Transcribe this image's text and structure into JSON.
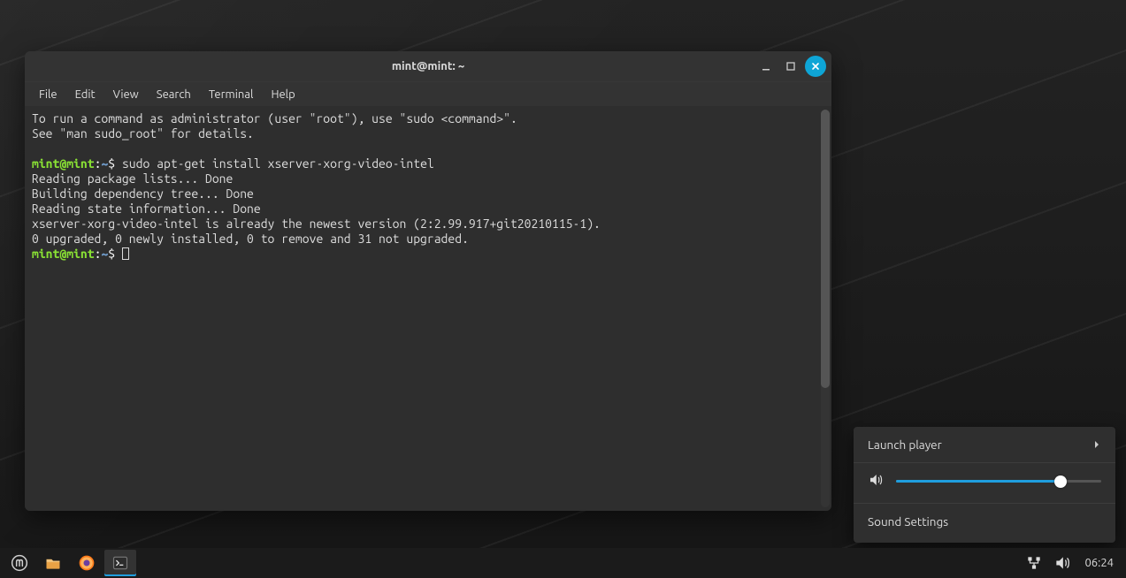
{
  "window": {
    "title": "mint@mint: ~",
    "menu": [
      "File",
      "Edit",
      "View",
      "Search",
      "Terminal",
      "Help"
    ]
  },
  "terminal": {
    "prompt": {
      "user": "mint",
      "host": "mint",
      "path": "~",
      "sigil": "$"
    },
    "lines": {
      "l0": "To run a command as administrator (user \"root\"), use \"sudo <command>\".",
      "l1": "See \"man sudo_root\" for details.",
      "cmd1": "sudo apt-get install xserver-xorg-video-intel",
      "l3": "Reading package lists... Done",
      "l4": "Building dependency tree... Done",
      "l5": "Reading state information... Done",
      "l6": "xserver-xorg-video-intel is already the newest version (2:2.99.917+git20210115-1).",
      "l7": "0 upgraded, 0 newly installed, 0 to remove and 31 not upgraded."
    }
  },
  "popup": {
    "launch": "Launch player",
    "sound_settings": "Sound Settings",
    "volume_percent": 80
  },
  "taskbar": {
    "clock": "06:24",
    "icons": {
      "menu": "mint-menu-icon",
      "files": "files-icon",
      "firefox": "firefox-icon",
      "terminal": "terminal-icon",
      "network": "network-icon",
      "sound": "sound-icon"
    }
  }
}
